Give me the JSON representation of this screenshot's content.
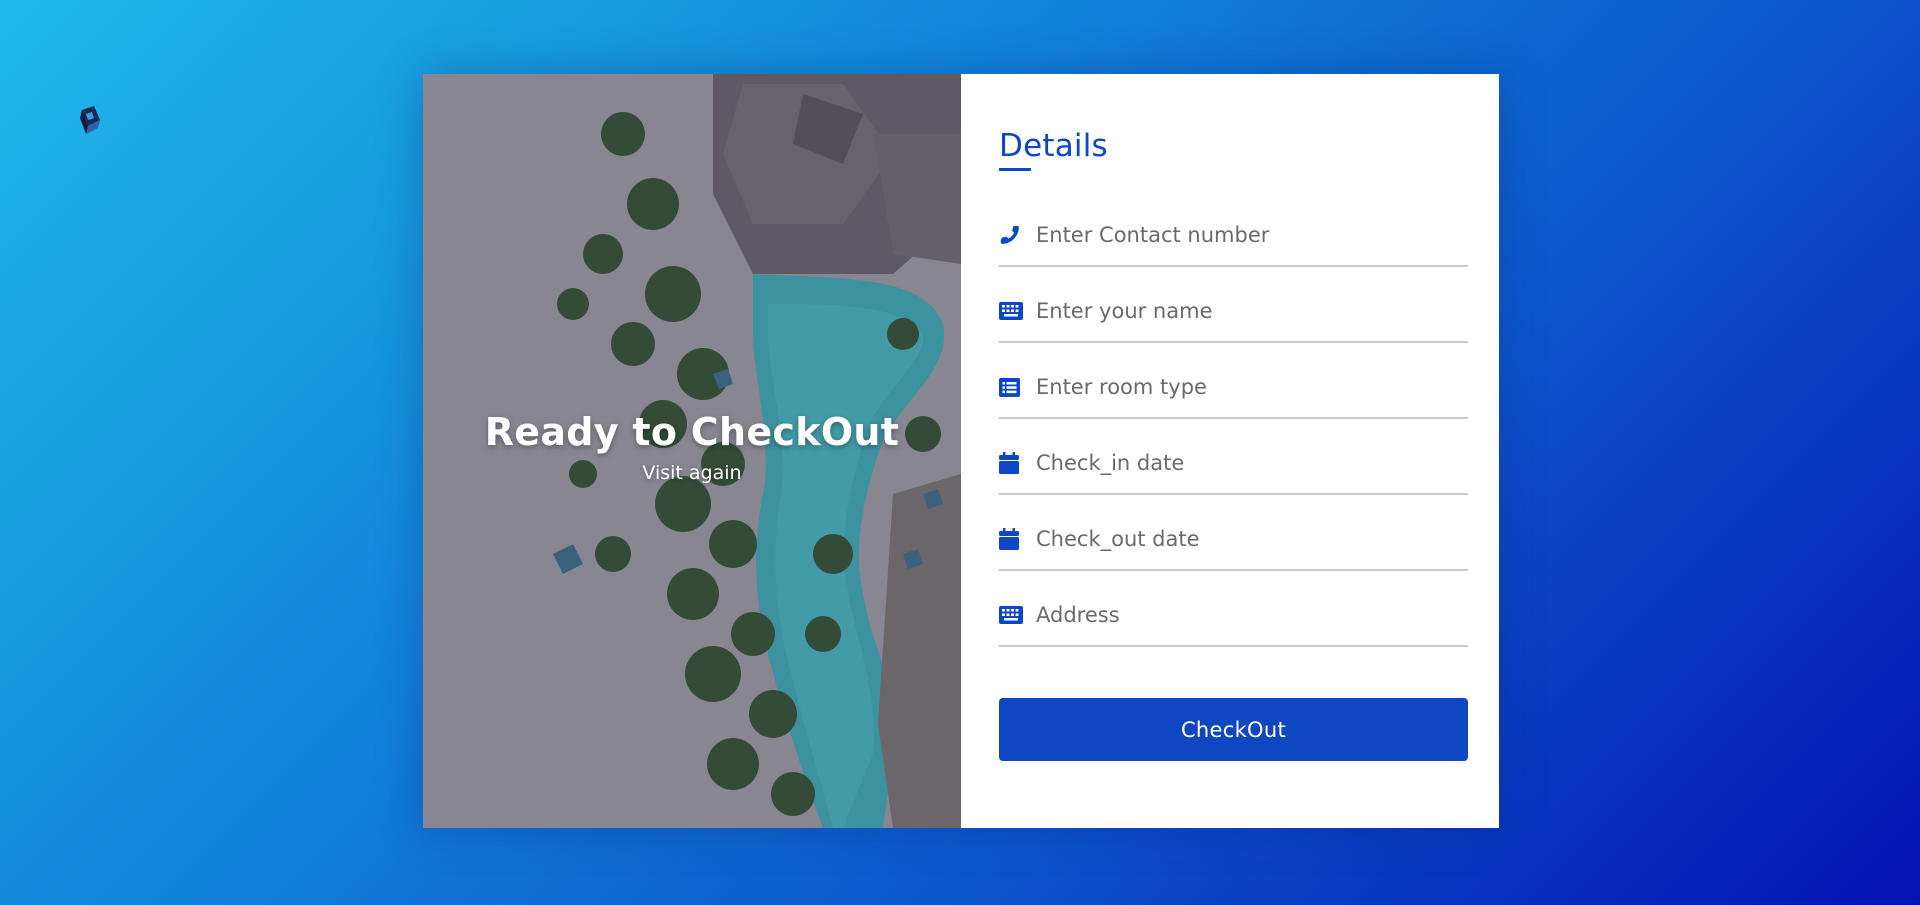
{
  "colors": {
    "accent": "#0d47c7",
    "button": "#0f47c2",
    "background_start": "#1fb9e8",
    "background_end": "#0412b3"
  },
  "hero": {
    "title": "Ready to CheckOut",
    "subtitle": "Visit again"
  },
  "form": {
    "title": "Details",
    "fields": [
      {
        "icon": "phone-icon",
        "placeholder": "Enter Contact number",
        "value": ""
      },
      {
        "icon": "keyboard-icon",
        "placeholder": "Enter your name",
        "value": ""
      },
      {
        "icon": "list-icon",
        "placeholder": "Enter room type",
        "value": ""
      },
      {
        "icon": "calendar-icon",
        "placeholder": "Check_in date",
        "value": ""
      },
      {
        "icon": "calendar-icon",
        "placeholder": "Check_out date",
        "value": ""
      },
      {
        "icon": "keyboard-icon",
        "placeholder": "Address",
        "value": ""
      }
    ],
    "submit_label": "CheckOut"
  }
}
